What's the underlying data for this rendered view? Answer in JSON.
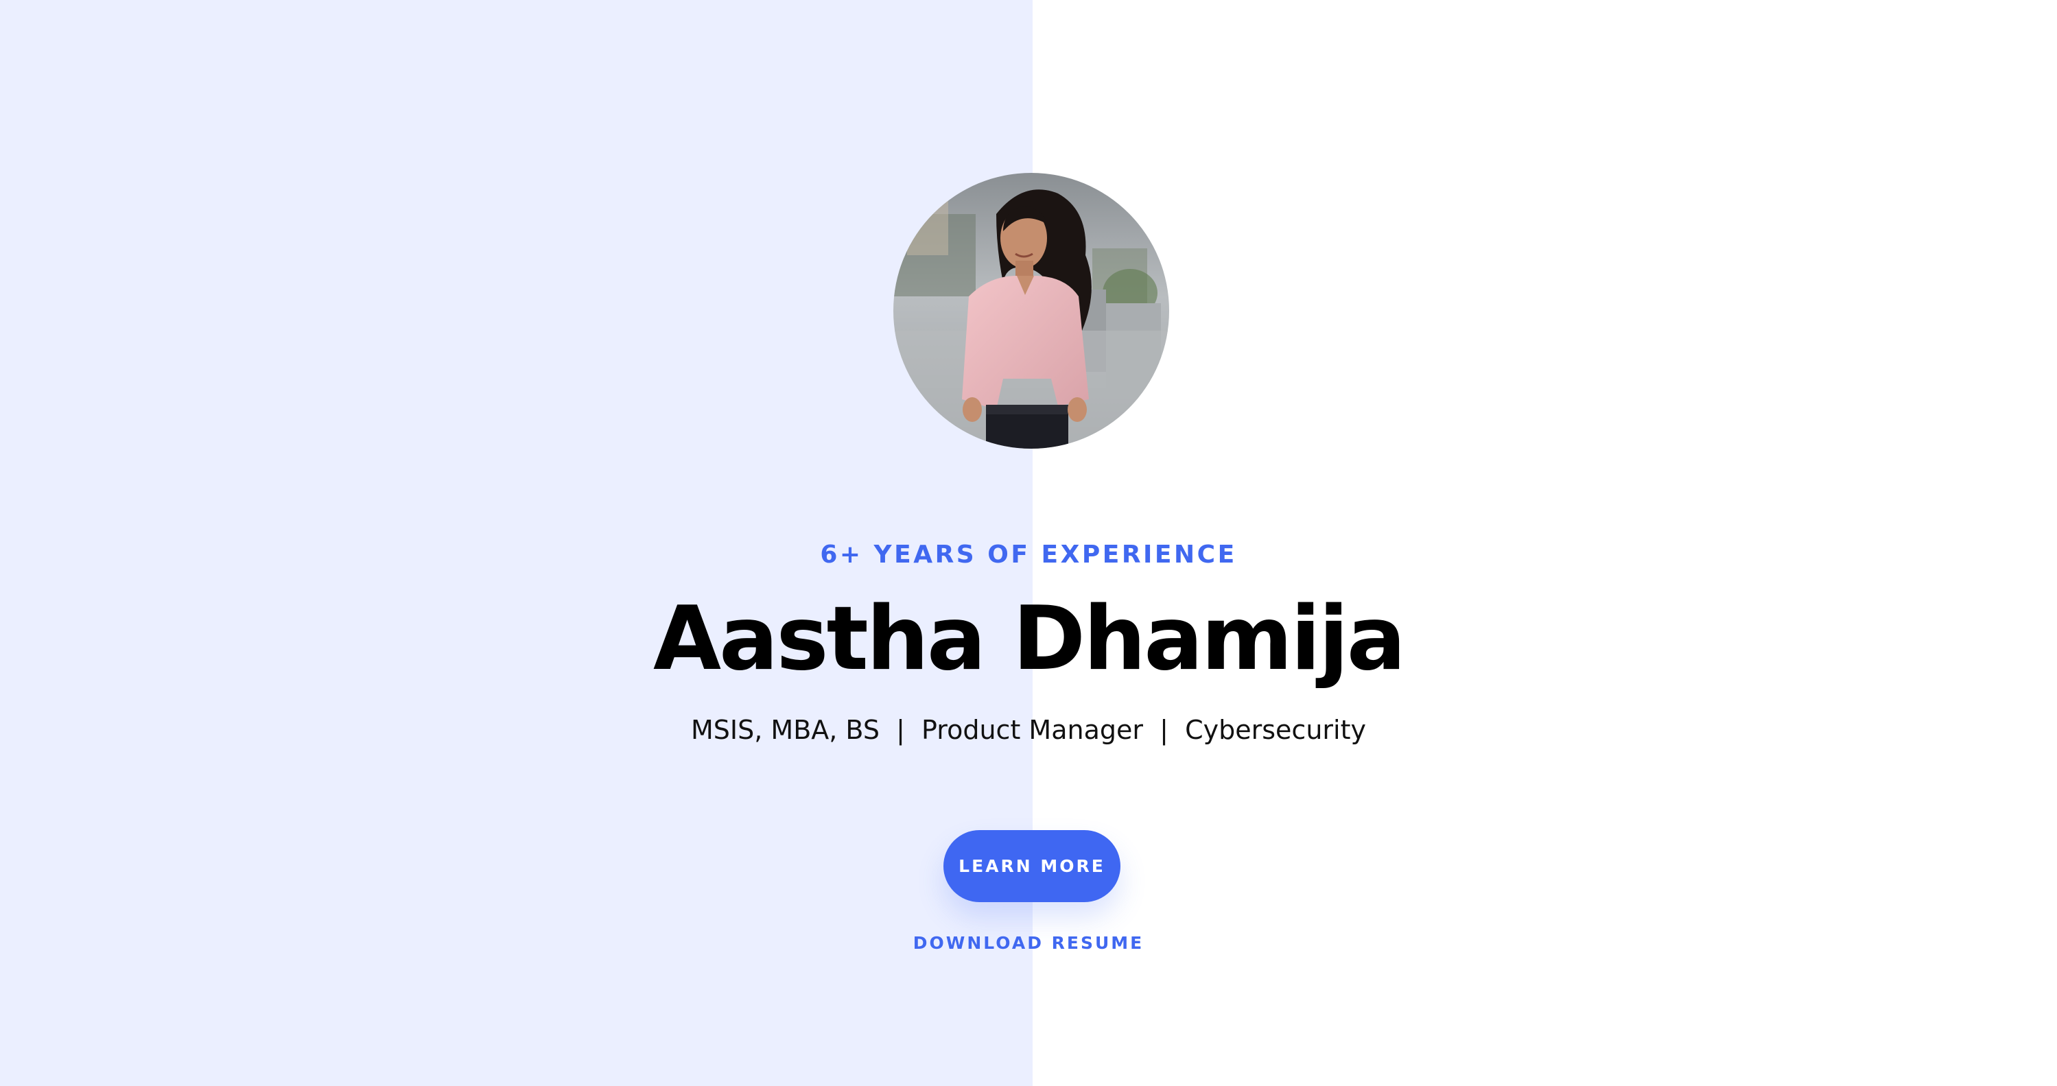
{
  "hero": {
    "eyebrow": "6+ YEARS OF EXPERIENCE",
    "name": "Aastha Dhamija",
    "subtitle": "MSIS, MBA, BS  |  Product Manager  |  Cybersecurity",
    "learn_more_label": "LEARN MORE",
    "download_label": "DOWNLOAD RESUME"
  },
  "colors": {
    "accent": "#3f67f2",
    "left_panel_bg": "#ebefff",
    "page_bg": "#ffffff",
    "heading": "#000000"
  },
  "icons": {
    "avatar": "profile-photo"
  }
}
